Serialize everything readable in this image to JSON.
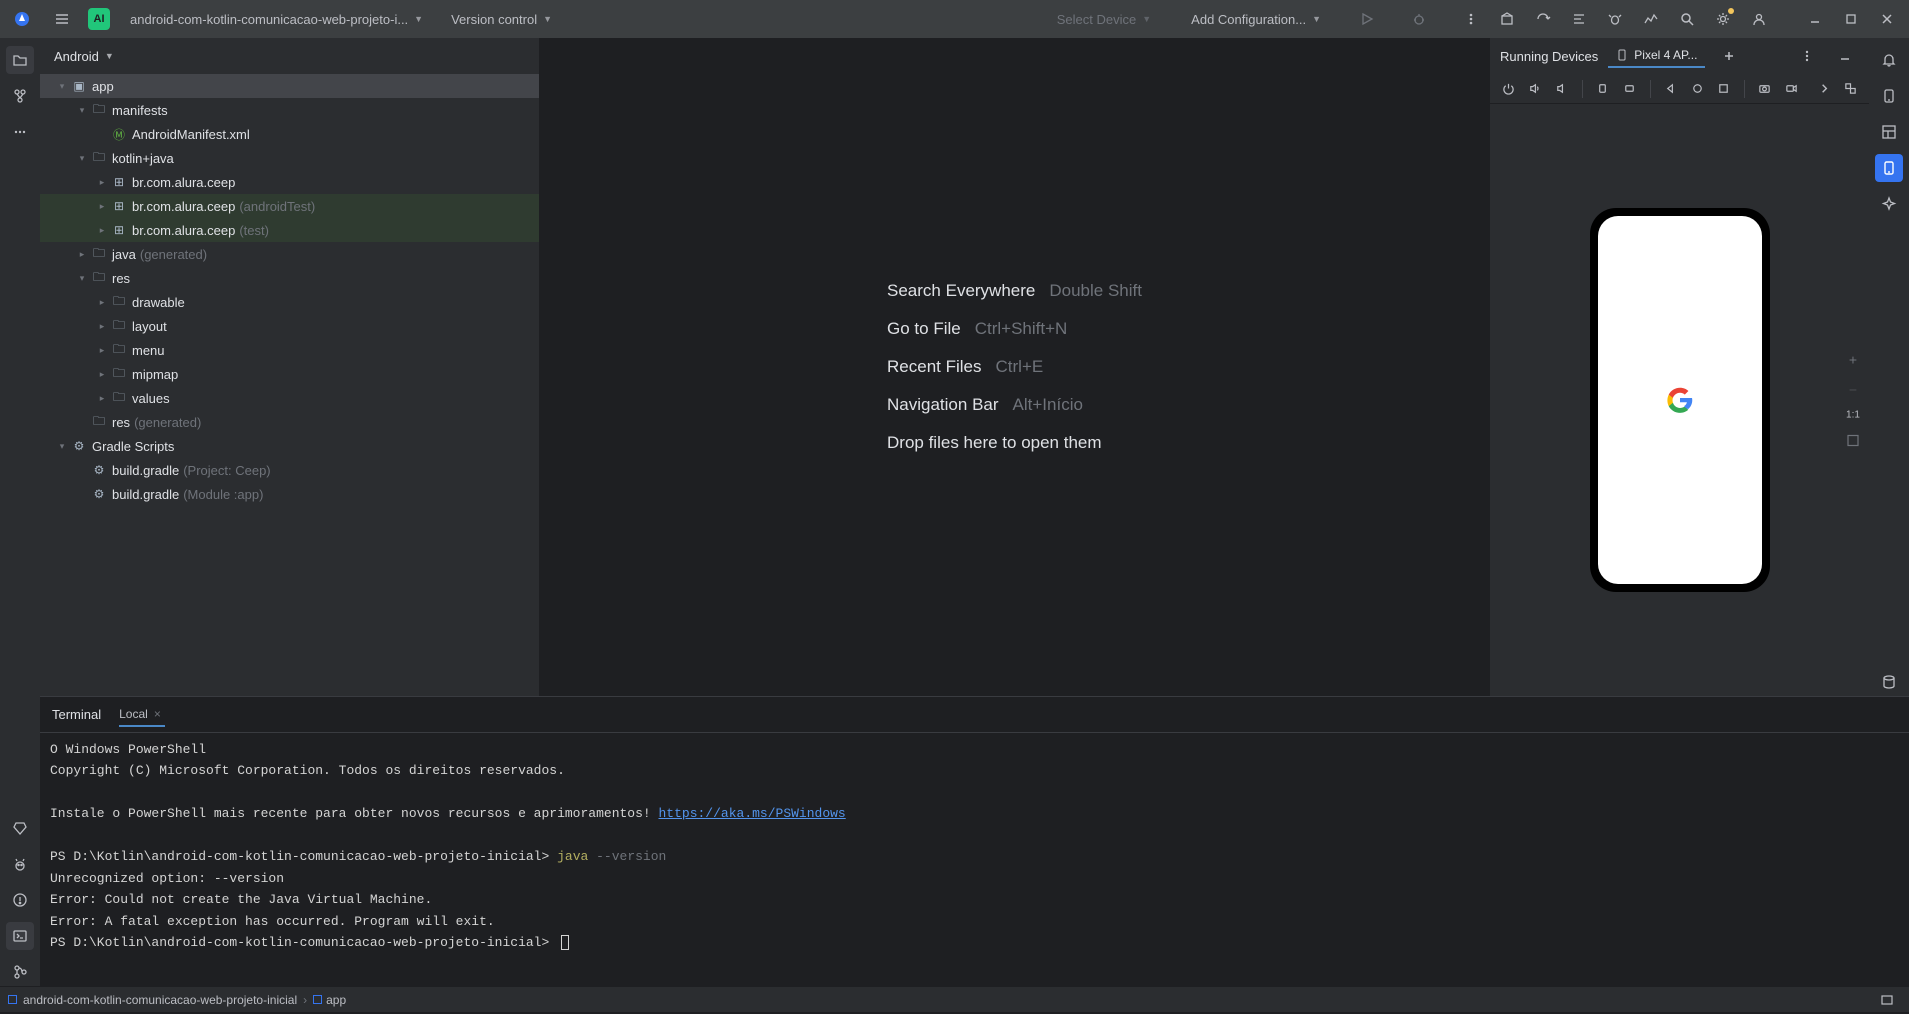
{
  "topbar": {
    "project_name": "android-com-kotlin-comunicacao-web-projeto-i...",
    "badge": "AI",
    "version_control": "Version control",
    "select_device": "Select Device",
    "add_config": "Add Configuration..."
  },
  "project": {
    "view_label": "Android",
    "tree": {
      "app": "app",
      "manifests": "manifests",
      "manifest_file": "AndroidManifest.xml",
      "kotlin_java": "kotlin+java",
      "pkg1": "br.com.alura.ceep",
      "pkg2": "br.com.alura.ceep",
      "pkg2_suffix": "(androidTest)",
      "pkg3": "br.com.alura.ceep",
      "pkg3_suffix": "(test)",
      "java_gen": "java",
      "java_gen_suffix": "(generated)",
      "res": "res",
      "drawable": "drawable",
      "layout": "layout",
      "menu": "menu",
      "mipmap": "mipmap",
      "values": "values",
      "res_gen": "res",
      "res_gen_suffix": "(generated)",
      "gradle_scripts": "Gradle Scripts",
      "build_gradle1": "build.gradle",
      "build_gradle1_suffix": "(Project: Ceep)",
      "build_gradle2": "build.gradle",
      "build_gradle2_suffix": "(Module :app)"
    }
  },
  "welcome": {
    "search": {
      "label": "Search Everywhere",
      "shortcut": "Double Shift"
    },
    "goto": {
      "label": "Go to File",
      "shortcut": "Ctrl+Shift+N"
    },
    "recent": {
      "label": "Recent Files",
      "shortcut": "Ctrl+E"
    },
    "nav": {
      "label": "Navigation Bar",
      "shortcut": "Alt+Início"
    },
    "drop": {
      "label": "Drop files here to open them"
    }
  },
  "running_devices": {
    "title": "Running Devices",
    "tab": "Pixel 4 AP...",
    "zoom_label": "1:1"
  },
  "terminal": {
    "title": "Terminal",
    "tab": "Local",
    "lines": {
      "l1": "O Windows PowerShell",
      "l2": "Copyright (C) Microsoft Corporation. Todos os direitos reservados.",
      "l3": "Instale o PowerShell mais recente para obter novos recursos e aprimoramentos! ",
      "l3_link": "https://aka.ms/PSWindows",
      "l4_prompt": "PS D:\\Kotlin\\android-com-kotlin-comunicacao-web-projeto-inicial> ",
      "l4_cmd": "java",
      "l4_flag": " --version",
      "l5": "Unrecognized option: --version",
      "l6": "Error: Could not create the Java Virtual Machine.",
      "l7": "Error: A fatal exception has occurred. Program will exit.",
      "l8_prompt": "PS D:\\Kotlin\\android-com-kotlin-comunicacao-web-projeto-inicial> "
    }
  },
  "status": {
    "crumb1": "android-com-kotlin-comunicacao-web-projeto-inicial",
    "crumb2": "app"
  }
}
